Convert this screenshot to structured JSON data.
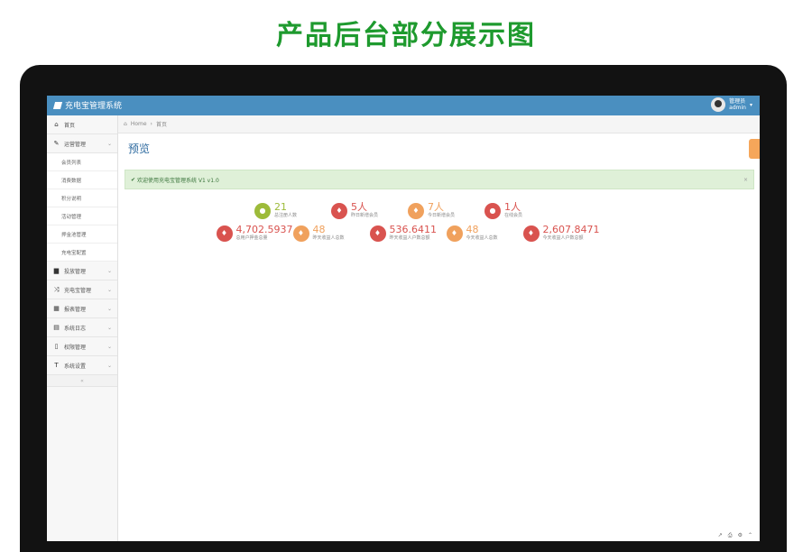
{
  "poster_title": "产品后台部分展示图",
  "colors": {
    "topbar": "#4a8fc0",
    "green": "#1e9a2e",
    "red": "#d9534f",
    "orange": "#f0a15d",
    "olive": "#9dbb3a"
  },
  "app": {
    "brand": "充电宝管理系统"
  },
  "user": {
    "name": "管理员",
    "role": "admin"
  },
  "breadcrumb": {
    "home": "Home",
    "current": "首页"
  },
  "sidebar": {
    "items": [
      {
        "icon": "home-icon",
        "label": "首页"
      },
      {
        "icon": "edit-icon",
        "label": "运营管理"
      },
      {
        "icon": "desktop-icon",
        "label": "投放管理"
      },
      {
        "icon": "shuffle-icon",
        "label": "充电宝管理"
      },
      {
        "icon": "calendar-icon",
        "label": "报表管理"
      },
      {
        "icon": "table-icon",
        "label": "系统日志"
      },
      {
        "icon": "file-icon",
        "label": "权限管理"
      },
      {
        "icon": "text-icon",
        "label": "系统设置"
      }
    ],
    "subitems": [
      "会员列表",
      "消费数据",
      "积分说明",
      "活动管理",
      "押金池管理",
      "充电宝配置"
    ]
  },
  "page": {
    "title": "预览"
  },
  "alert": {
    "text": "欢迎使用充电宝管理系统 V1 v1.0"
  },
  "stats": {
    "row1": [
      {
        "value": "21",
        "label": "总注册人数",
        "color": "olive",
        "icon": "comment-icon"
      },
      {
        "value": "5人",
        "label": "昨日新增会员",
        "color": "red",
        "icon": "twitter-icon"
      },
      {
        "value": "7人",
        "label": "今日新增会员",
        "color": "orange",
        "icon": "twitter-icon"
      },
      {
        "value": "1人",
        "label": "在线会员",
        "color": "red",
        "icon": "comment-icon"
      }
    ],
    "row2": [
      {
        "value": "4,702.5937",
        "label": "总用户押金总量",
        "color": "red",
        "icon": "twitter-icon"
      },
      {
        "value": "48",
        "label": "昨天收益人总数",
        "color": "orange",
        "icon": "twitter-icon"
      },
      {
        "value": "536.6411",
        "label": "昨天收益人户数总额",
        "color": "red",
        "icon": "twitter-icon"
      },
      {
        "value": "48",
        "label": "今天收益人总数",
        "color": "orange",
        "icon": "twitter-icon"
      },
      {
        "value": "2,607.8471",
        "label": "今天收益人户数总额",
        "color": "red",
        "icon": "twitter-icon"
      }
    ]
  }
}
